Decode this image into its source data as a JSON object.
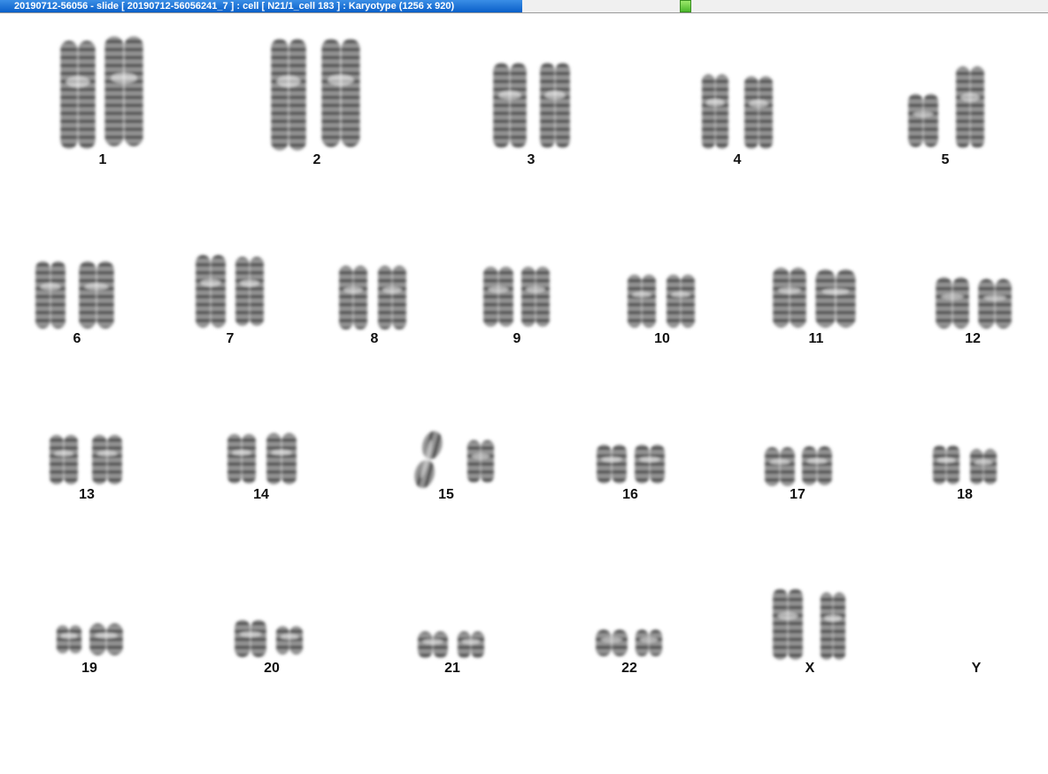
{
  "window": {
    "title": "20190712-56056 - slide [  20190712-56056241_7 ] : cell [ N21/1_cell 183 ] : Karyotype  (1256 x 920)"
  },
  "karyotype": {
    "labels": [
      "1",
      "2",
      "3",
      "4",
      "5",
      "6",
      "7",
      "8",
      "9",
      "10",
      "11",
      "12",
      "13",
      "14",
      "15",
      "16",
      "17",
      "18",
      "19",
      "20",
      "21",
      "22",
      "X",
      "Y"
    ]
  }
}
